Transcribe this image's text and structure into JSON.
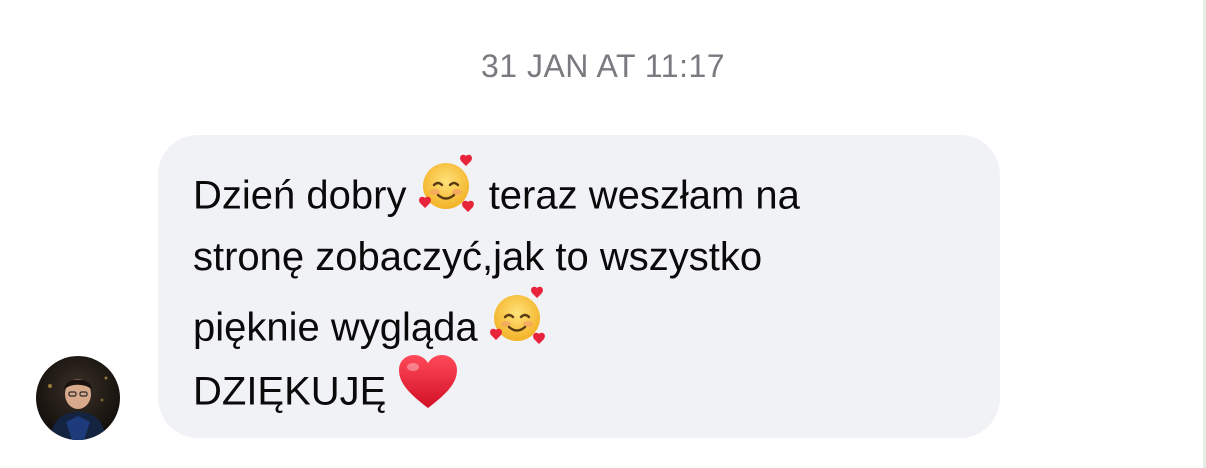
{
  "chat": {
    "timestamp": "31 JAN AT 11:17",
    "message": {
      "line1_a": "Dzień dobry",
      "line1_b": "teraz weszłam na",
      "line2": "stronę zobaczyć,jak to wszystko",
      "line3": "pięknie wygląda",
      "line4": "DZIĘKUJĘ"
    },
    "emojis": [
      "smiling-face-with-hearts-icon",
      "red-heart-icon"
    ]
  },
  "colors": {
    "bubble": "#f1f2f6",
    "timestamp": "#7a7a80",
    "text": "#0a0a0a",
    "heart": "#e0182d"
  }
}
